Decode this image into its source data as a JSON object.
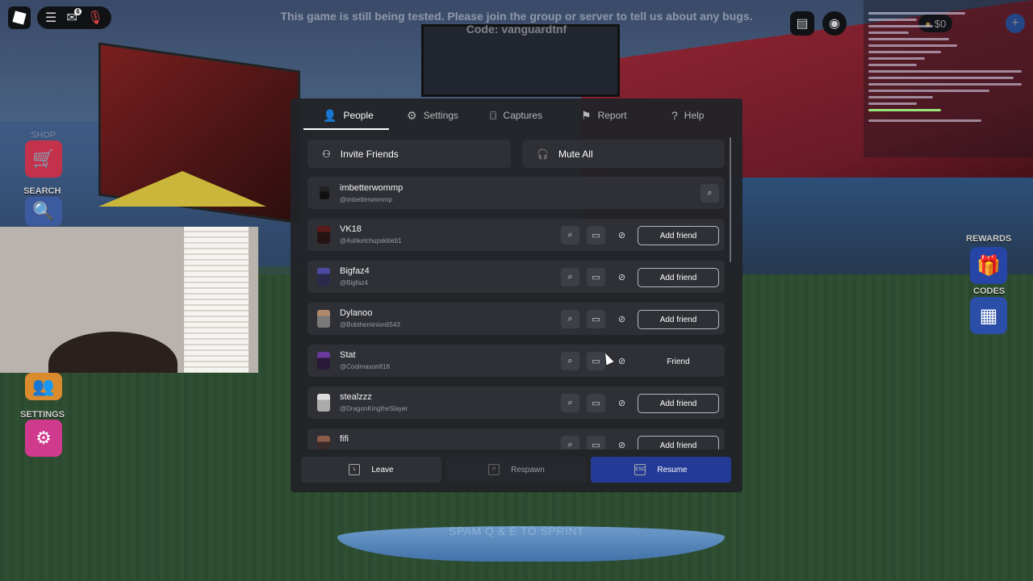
{
  "banner": "This game is still being tested. Please join the group or server to tell us about any bugs. Code: vanguardtnf",
  "sprint_hint": "SPAM Q & E TO SPRINT",
  "hud": {
    "notification_count": "6",
    "money": "$0",
    "left_labels": {
      "shop": "SHOP",
      "search": "SEARCH",
      "settings": "SETTINGS"
    },
    "right_labels": {
      "rewards": "REWARDS",
      "codes": "CODES"
    },
    "icons": [
      "roblox-logo-icon",
      "hamburger-menu-icon",
      "chat-icon",
      "microphone-icon",
      "leaderboard-icon",
      "eye-icon",
      "money-icon",
      "plus-icon",
      "cart-icon",
      "gift-icon",
      "qr-code-icon",
      "gear-icon",
      "friends-icon"
    ]
  },
  "menu": {
    "tabs": [
      {
        "label": "People",
        "icon": "people-icon",
        "active": true
      },
      {
        "label": "Settings",
        "icon": "gear-icon",
        "active": false
      },
      {
        "label": "Captures",
        "icon": "camera-icon",
        "active": false
      },
      {
        "label": "Report",
        "icon": "flag-icon",
        "active": false
      },
      {
        "label": "Help",
        "icon": "help-icon",
        "active": false
      }
    ],
    "invite_label": "Invite Friends",
    "mute_all_label": "Mute All",
    "self": {
      "name": "imbetterwommp",
      "handle": "@imbetterwommp"
    },
    "players": [
      {
        "name": "VK18",
        "handle": "@Ashketchupskibidi1",
        "action": "Add friend"
      },
      {
        "name": "Bigfaz4",
        "handle": "@Bigfaz4",
        "action": "Add friend"
      },
      {
        "name": "Dylanoo",
        "handle": "@Bobtheminion6543",
        "action": "Add friend"
      },
      {
        "name": "Stat",
        "handle": "@Coolmason818",
        "action": "Friend"
      },
      {
        "name": "stealzzz",
        "handle": "@DragonKingtheSlayer",
        "action": "Add friend"
      },
      {
        "name": "fifi",
        "handle": "",
        "action": "Add friend"
      }
    ],
    "bottom": {
      "leave": {
        "label": "Leave",
        "key": "L"
      },
      "respawn": {
        "label": "Respawn",
        "key": "R"
      },
      "resume": {
        "label": "Resume",
        "key": "ESC"
      }
    }
  },
  "colors": {
    "panel": "#212328",
    "row": "#2e3036",
    "resume": "#233a96",
    "shop_tile": "#c4314b",
    "settings_tile": "#d03a8c"
  }
}
